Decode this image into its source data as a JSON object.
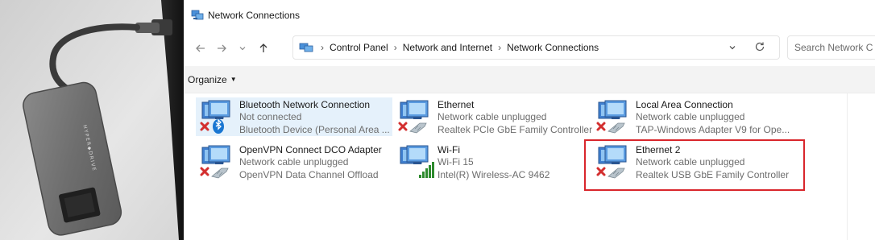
{
  "window": {
    "title": "Network Connections"
  },
  "navigation": {
    "back_icon": "arrow-left-icon",
    "forward_icon": "arrow-right-icon",
    "recent_icon": "chevron-down-icon",
    "up_icon": "arrow-up-icon"
  },
  "address": {
    "crumbs": [
      "Control Panel",
      "Network and Internet",
      "Network Connections"
    ],
    "separator": "›",
    "search_placeholder": "Search Network C"
  },
  "commandbar": {
    "organize_label": "Organize"
  },
  "connections": [
    {
      "name": "Bluetooth Network Connection",
      "status": "Not connected",
      "device": "Bluetooth Device (Personal Area ...",
      "kind": "bluetooth",
      "selected": true
    },
    {
      "name": "Ethernet",
      "status": "Network cable unplugged",
      "device": "Realtek PCIe GbE Family Controller",
      "kind": "ethernet-unplugged",
      "selected": false
    },
    {
      "name": "Local Area Connection",
      "status": "Network cable unplugged",
      "device": "TAP-Windows Adapter V9 for Ope...",
      "kind": "ethernet-unplugged",
      "selected": false
    },
    {
      "name": "OpenVPN Connect DCO Adapter",
      "status": "Network cable unplugged",
      "device": "OpenVPN Data Channel Offload",
      "kind": "ethernet-unplugged",
      "selected": false
    },
    {
      "name": "Wi-Fi",
      "status": "Wi-Fi 15",
      "device": "Intel(R) Wireless-AC 9462",
      "kind": "wifi-connected",
      "selected": false
    },
    {
      "name": "Ethernet 2",
      "status": "Network cable unplugged",
      "device": "Realtek USB GbE Family Controller",
      "kind": "ethernet-unplugged",
      "selected": false,
      "highlighted": true
    }
  ],
  "colors": {
    "highlight_border": "#d9262c",
    "selection_bg": "#e5f1fb",
    "error_x": "#d32f2f",
    "bluetooth_blue": "#1976d2",
    "wifi_green": "#2e8b2e"
  },
  "photo": {
    "subject": "usb-c-hub-photo",
    "hub_brand": "HYPER◆DRIVE"
  }
}
